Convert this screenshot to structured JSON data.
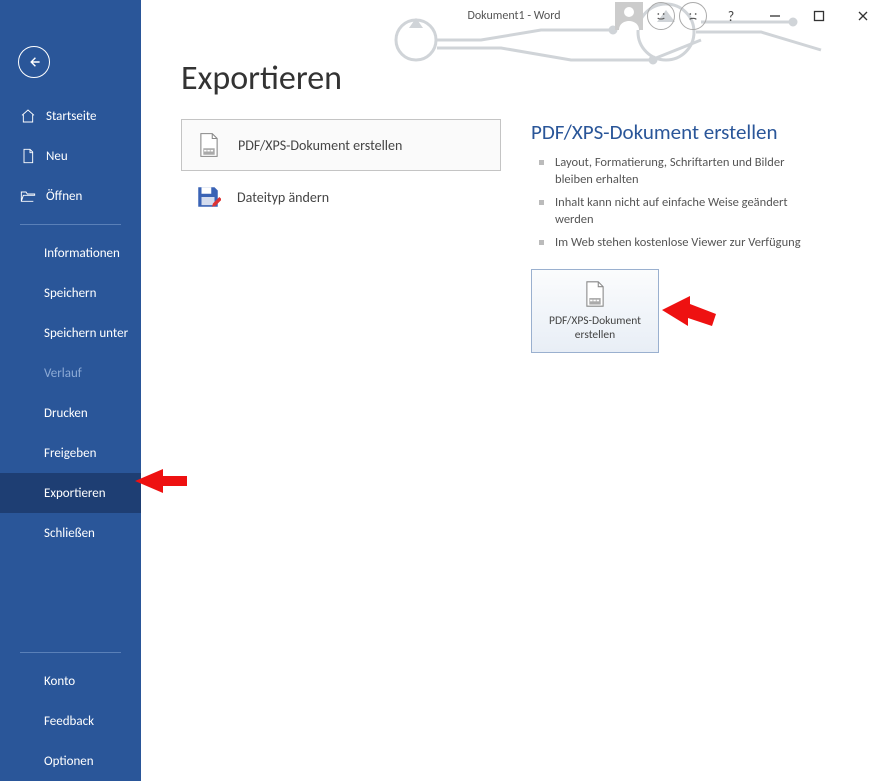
{
  "window": {
    "title": "Dokument1  -  Word",
    "help_label": "?"
  },
  "sidebar": {
    "main_items": [
      {
        "id": "home",
        "label": "Startseite",
        "icon": "home"
      },
      {
        "id": "new",
        "label": "Neu",
        "icon": "file"
      },
      {
        "id": "open",
        "label": "Öffnen",
        "icon": "folder-open"
      }
    ],
    "sub_items": [
      {
        "id": "info",
        "label": "Informationen"
      },
      {
        "id": "save",
        "label": "Speichern"
      },
      {
        "id": "saveas",
        "label": "Speichern unter"
      },
      {
        "id": "history",
        "label": "Verlauf",
        "disabled": true
      },
      {
        "id": "print",
        "label": "Drucken"
      },
      {
        "id": "share",
        "label": "Freigeben"
      },
      {
        "id": "export",
        "label": "Exportieren",
        "active": true
      },
      {
        "id": "close",
        "label": "Schließen"
      }
    ],
    "footer_items": [
      {
        "id": "account",
        "label": "Konto"
      },
      {
        "id": "feedback",
        "label": "Feedback"
      },
      {
        "id": "options",
        "label": "Optionen"
      }
    ]
  },
  "page": {
    "heading": "Exportieren",
    "options": [
      {
        "id": "pdfxps",
        "label": "PDF/XPS-Dokument erstellen",
        "selected": true
      },
      {
        "id": "changefmt",
        "label": "Dateityp ändern"
      }
    ],
    "detail": {
      "heading": "PDF/XPS-Dokument erstellen",
      "bullets": [
        "Layout, Formatierung, Schriftarten und Bilder bleiben erhalten",
        "Inhalt kann nicht auf einfache Weise geändert werden",
        "Im Web stehen kostenlose Viewer zur Verfügung"
      ],
      "action_label": "PDF/XPS-Dokument erstellen"
    }
  }
}
